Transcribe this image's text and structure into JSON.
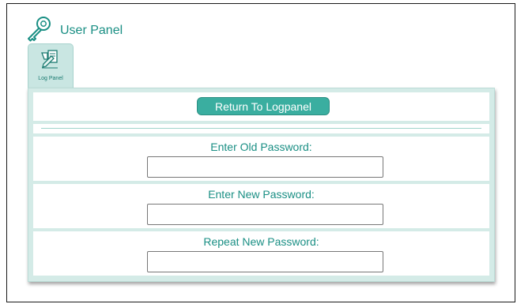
{
  "header": {
    "title": "User Panel",
    "icon": "key-icon"
  },
  "tabs": [
    {
      "label": "Log Panel",
      "icon": "log-panel-icon",
      "active": true
    }
  ],
  "panel": {
    "return_button_label": "Return To Logpanel",
    "fields": [
      {
        "label": "Enter Old Password:",
        "value": "",
        "placeholder": ""
      },
      {
        "label": "Enter New Password:",
        "value": "",
        "placeholder": ""
      },
      {
        "label": "Repeat New Password:",
        "value": "",
        "placeholder": ""
      }
    ]
  },
  "colors": {
    "accent": "#1a8f84",
    "button": "#3aaea0",
    "panel_bg": "#d4ebe7",
    "tab_bg": "#c9e6e2"
  }
}
